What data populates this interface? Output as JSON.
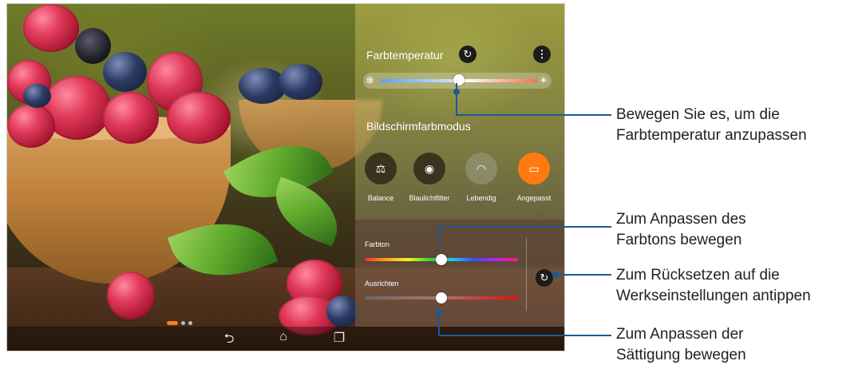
{
  "panel": {
    "title": "Farbtemperatur",
    "color_temperature_level": 0.5,
    "screen_color_mode_title": "Bildschirmfarbmodus",
    "modes": [
      {
        "label": "Balance",
        "icon": "scale-icon",
        "selected": false
      },
      {
        "label": "Blaulichtfilter",
        "icon": "eye-shield-icon",
        "selected": false
      },
      {
        "label": "Lebendig",
        "icon": "rainbow-icon",
        "selected": false
      },
      {
        "label": "Angepasst",
        "icon": "custom-screen-icon",
        "selected": true
      }
    ],
    "hue_label": "Farbton",
    "hue_level": 0.5,
    "saturation_label": "Ausrichten",
    "saturation_level": 0.5
  },
  "nav": {
    "back_icon": "back-icon",
    "home_icon": "home-icon",
    "recents_icon": "recent-apps-icon"
  },
  "callouts": {
    "temperature_line1": "Bewegen Sie es, um die",
    "temperature_line2": "Farbtemperatur anzupassen",
    "hue_line1": "Zum Anpassen des",
    "hue_line2": "Farbtons bewegen",
    "reset_line1": "Zum Rücksetzen auf die",
    "reset_line2": "Werkseinstellungen antippen",
    "saturation_line1": "Zum Anpassen der",
    "saturation_line2": "Sättigung bewegen"
  },
  "colors": {
    "accent": "#ff7a12",
    "callout_line": "#1b5a96"
  }
}
